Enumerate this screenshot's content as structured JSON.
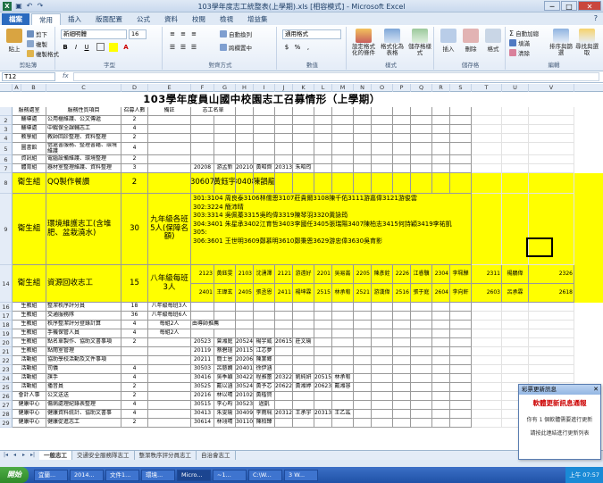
{
  "window": {
    "title": "103學年度志工統整表(上學期).xls [相容模式] - Microsoft Excel",
    "app_icon": "X",
    "controls": [
      "─",
      "□",
      "✕"
    ]
  },
  "ribbon": {
    "tabs": [
      "檔案",
      "常用",
      "插入",
      "版面配置",
      "公式",
      "資料",
      "校閱",
      "檢視",
      "增益集"
    ],
    "help_icon": "?",
    "clipboard": {
      "label": "剪貼簿",
      "paste": "貼上",
      "cut": "剪下",
      "copy": "複製",
      "format_painter": "複製格式"
    },
    "font": {
      "label": "字型",
      "name": "新細明體",
      "size": "16",
      "bold": "B",
      "italic": "I",
      "underline": "U"
    },
    "alignment": {
      "label": "對齊方式",
      "wrap": "自動換列",
      "merge": "跨欄置中"
    },
    "number": {
      "label": "數值",
      "format": "通用格式"
    },
    "styles": {
      "label": "樣式",
      "conditional": "設定格式化的條件",
      "as_table": "格式化為表格",
      "cell_styles": "儲存格樣式"
    },
    "cells": {
      "label": "儲存格",
      "insert": "插入",
      "delete": "刪除",
      "format": "格式"
    },
    "editing": {
      "label": "編輯",
      "autosum": "自動加總",
      "fill": "填滿",
      "clear": "清除",
      "sort": "排序與篩選",
      "find": "尋找與選取"
    }
  },
  "formula_bar": {
    "name_box": "T12",
    "fx": "fx",
    "value": ""
  },
  "columns": [
    "A",
    "B",
    "C",
    "D",
    "E",
    "F",
    "G",
    "H",
    "I",
    "J",
    "K",
    "L",
    "M",
    "N",
    "O",
    "P",
    "Q",
    "R",
    "S",
    "T",
    "U",
    "V"
  ],
  "sheet": {
    "title": "103學年度員山國中校園志工召募情形（上學期）",
    "header": {
      "office": "服務處室",
      "item": "服務性質項目",
      "count": "召募人數",
      "note": "備註",
      "names_title": "志工名單"
    },
    "rows": [
      {
        "n": "2",
        "office": "輔導處",
        "item": "公用櫃維護、公文傳遞",
        "count": "2"
      },
      {
        "n": "3",
        "office": "輔導處",
        "item": "中輟保全課輔志工",
        "count": "4"
      },
      {
        "n": "4",
        "office": "教學組",
        "item": "教師回診整理、資料整理",
        "count": "2"
      },
      {
        "n": "5",
        "office": "圖書館",
        "item": "借還書服務、整理書籍、環境維護",
        "count": "4"
      },
      {
        "n": "6",
        "office": "資訊組",
        "item": "電腦設備維護、環境整理",
        "count": "2"
      },
      {
        "n": "7",
        "office": "體育組",
        "item": "器材室整理維護、資料整理",
        "count": "3",
        "names": [
          "20208",
          "游孟新",
          "20210",
          "黃昭齊",
          "20313",
          "朱昭筠"
        ]
      },
      {
        "n": "8",
        "office": "衛生組",
        "item": "QQ製作餐讚",
        "count": "2",
        "names": [
          "30607",
          "黃鈺宇",
          "30408",
          "陳韻龍"
        ]
      },
      {
        "n": "9",
        "office": "衛生組",
        "item": "環境維護志工(含堆肥、盆栽澆水)",
        "count": "30",
        "note": "九年級各班5人(保障名額)",
        "list": [
          "301:3104 周良泰3106林儒恩3107莊貴爾3108陳千佑3111游嘉偉3121游俊雲",
          "302:3224 簡沛晴",
          "303:3314 吳佩蓁3315吳昀偉3319陳琴羽3320黃詠筠",
          "304:3401 朱星承3402江育哲3403李國任3405張瑞陽3407陳柏志3415何詩穎3419李祐凱",
          "305:",
          "306:3601 王世明3609鄭慕明3610鄭秉恩3629游忠偉3630吳育影"
        ]
      },
      {
        "n": "14",
        "office": "衛生組",
        "item": "資源回收志工",
        "count": "15",
        "note": "八年級每班3人",
        "recycle_a": [
          "2123",
          "黃鈺雯",
          "2103",
          "沈湧澤",
          "2121",
          "游遠好",
          "2201",
          "吳易崙",
          "2205",
          "陳彥銓",
          "2226",
          "江睿驥",
          "2304",
          "李珮驊",
          "2311",
          "楊鵬偉",
          "2326",
          "李宛霖"
        ],
        "recycle_b": [
          "2401",
          "王瑋玄",
          "2405",
          "張丞恩",
          "2411",
          "楊坤霖",
          "2515",
          "林承宥",
          "2521",
          "游漢偉",
          "2516",
          "張于庭",
          "2604",
          "李向軒",
          "2603",
          "呂承霖",
          "2618",
          "曾語庭"
        ]
      },
      {
        "n": "16",
        "office": "生教組",
        "item": "整潔秩序評分員",
        "count": "18",
        "note": "八年級每班3人"
      },
      {
        "n": "17",
        "office": "生教組",
        "item": "交通服務隊",
        "count": "36",
        "note": "八年級每班6人"
      },
      {
        "n": "18",
        "office": "生教組",
        "item": "秩序整潔評分登錄計算",
        "count": "4",
        "note": "每組2人",
        "extra": "由導師推薦"
      },
      {
        "n": "19",
        "office": "生教組",
        "item": "手機保管人員",
        "count": "4",
        "note": "每組2人"
      },
      {
        "n": "20",
        "office": "生教組",
        "item": "點名單製作、協助文書事項",
        "count": "2",
        "names": [
          "20523",
          "曾湘庭",
          "20524",
          "楊宇威",
          "20615",
          "莊文瑜"
        ]
      },
      {
        "n": "21",
        "office": "生教組",
        "item": "點閱室管理",
        "count": "",
        "names": [
          "20119",
          "蔡碧瑄",
          "20115",
          "江芯夢"
        ]
      },
      {
        "n": "22",
        "office": "活動組",
        "item": "協助學校活動及文件事項",
        "count": "",
        "names": [
          "20211",
          "簡士恩",
          "20206",
          "陳業鄉"
        ]
      },
      {
        "n": "23",
        "office": "活動組",
        "item": "司儀",
        "count": "4",
        "names": [
          "30503",
          "呂慈嫻",
          "20401",
          "徐伊涵"
        ]
      },
      {
        "n": "24",
        "office": "活動組",
        "item": "旗手",
        "count": "4",
        "names": [
          "30416",
          "吳季穎",
          "30422",
          "程雅蕾",
          "20322",
          "劉純妍",
          "20515",
          "林承宥"
        ]
      },
      {
        "n": "25",
        "office": "活動組",
        "item": "播音員",
        "count": "2",
        "names": [
          "30525",
          "戴以涵",
          "30524",
          "黃予芯",
          "20622",
          "黃湘婷",
          "20623",
          "戴湘容"
        ]
      },
      {
        "n": "26",
        "office": "會計人事",
        "item": "公文送送",
        "count": "2",
        "names": [
          "20216",
          "林以晴",
          "20102",
          "黃楷賀"
        ]
      },
      {
        "n": "27",
        "office": "健康中心",
        "item": "傷病處理紀錄表整理",
        "count": "4",
        "names": [
          "30515",
          "李心昀",
          "30523",
          "過凱"
        ]
      },
      {
        "n": "28",
        "office": "健康中心",
        "item": "健康資料統計、協助文書事",
        "count": "4",
        "names": [
          "30413",
          "朱雯瑜",
          "30409",
          "李雨珮",
          "20312",
          "王承宇",
          "20313",
          "王乙竑"
        ]
      },
      {
        "n": "29",
        "office": "健康中心",
        "item": "健康促進志工",
        "count": "2",
        "names": [
          "30614",
          "林翊晴",
          "30110",
          "陳柏臻"
        ]
      }
    ],
    "selected_cell_label": "T12"
  },
  "sheet_tabs": [
    "一般志工",
    "交通安全服務隊志工",
    "整潔秩序評分員志工",
    "自治會志工"
  ],
  "popup": {
    "title": "彩票更新訊息",
    "close": "✕",
    "heading": "軟體更新訊息通報",
    "message": "你有 1 個軟體需要進行更新",
    "link": "請按此連結進行更新列表"
  },
  "taskbar": {
    "start": "開始",
    "items": [
      "宜蘭...",
      "2014...",
      "文件1...",
      "環境...",
      "Micro...",
      "~1...",
      "C:\\W...",
      "3 W..."
    ],
    "clock": "上午 07:57"
  },
  "colors": {
    "highlight": "#ffff00",
    "ribbon": "#dfe9f5",
    "taskbar": "#2052a7"
  }
}
